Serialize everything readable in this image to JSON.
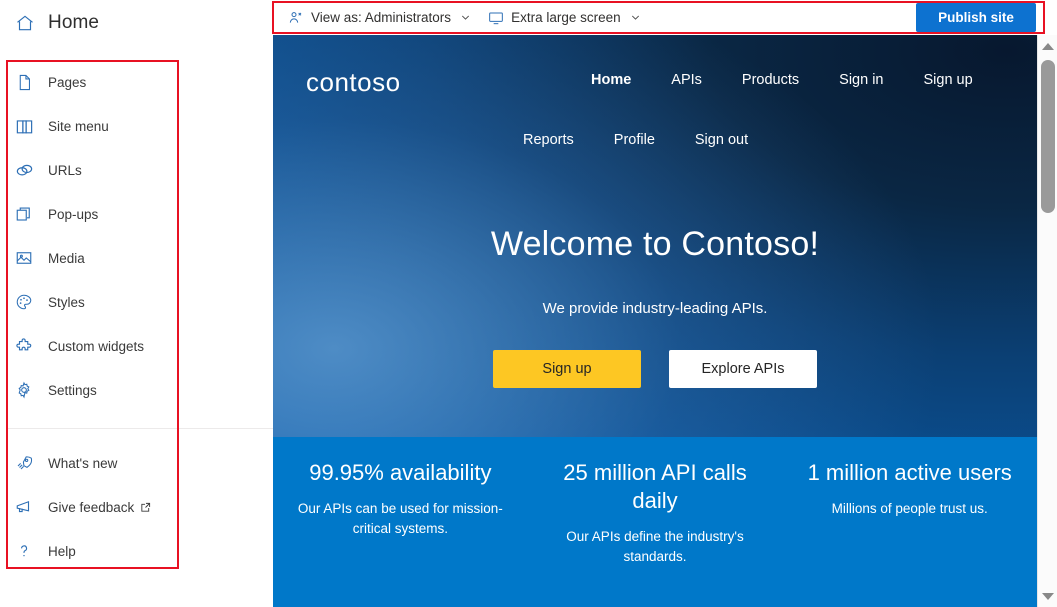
{
  "header": {
    "title": "Home",
    "home_icon": "home-icon"
  },
  "sidebar": {
    "primary_items": [
      {
        "label": "Pages",
        "icon": "page-icon"
      },
      {
        "label": "Site menu",
        "icon": "book-icon"
      },
      {
        "label": "URLs",
        "icon": "link-icon"
      },
      {
        "label": "Pop-ups",
        "icon": "popup-icon"
      },
      {
        "label": "Media",
        "icon": "image-icon"
      },
      {
        "label": "Styles",
        "icon": "palette-icon"
      },
      {
        "label": "Custom widgets",
        "icon": "puzzle-icon"
      },
      {
        "label": "Settings",
        "icon": "gear-icon"
      }
    ],
    "secondary_items": [
      {
        "label": "What's new",
        "icon": "rocket-icon",
        "external": false
      },
      {
        "label": "Give feedback",
        "icon": "megaphone-icon",
        "external": true
      },
      {
        "label": "Help",
        "icon": "question-icon",
        "external": false
      }
    ]
  },
  "toolbar": {
    "view_as": {
      "label": "View as: Administrators",
      "icon": "person-icon",
      "caret": "chevron-down-icon"
    },
    "screen_size": {
      "label": "Extra large screen",
      "icon": "monitor-icon",
      "caret": "chevron-down-icon"
    },
    "publish_label": "Publish site",
    "publish_color": "#0d72d0"
  },
  "annotations": {
    "highlight_color": "#e81123",
    "boxes": [
      "sidebar-menu",
      "top-toolbar"
    ]
  },
  "preview": {
    "brand": "contoso",
    "nav_row_1": [
      {
        "label": "Home",
        "active": true
      },
      {
        "label": "APIs",
        "active": false
      },
      {
        "label": "Products",
        "active": false
      },
      {
        "label": "Sign in",
        "active": false
      },
      {
        "label": "Sign up",
        "active": false
      }
    ],
    "nav_row_2": [
      {
        "label": "Reports",
        "active": false
      },
      {
        "label": "Profile",
        "active": false
      },
      {
        "label": "Sign out",
        "active": false
      }
    ],
    "hero": {
      "title": "Welcome to Contoso!",
      "subtitle": "We provide industry-leading APIs.",
      "primary_cta": "Sign up",
      "secondary_cta": "Explore APIs",
      "primary_cta_color": "#fdc723"
    },
    "stats_band_color": "#0078c9",
    "stats": [
      {
        "title": "99.95% availability",
        "description": "Our APIs can be used for mission-critical systems."
      },
      {
        "title": "25 million API calls daily",
        "description": "Our APIs define the industry's standards."
      },
      {
        "title": "1 million active users",
        "description": "Millions of people trust us."
      }
    ]
  },
  "scrollbar": {
    "up_icon": "scroll-up-arrow-icon",
    "down_icon": "scroll-down-arrow-icon",
    "thumb": "scrollbar-thumb"
  }
}
